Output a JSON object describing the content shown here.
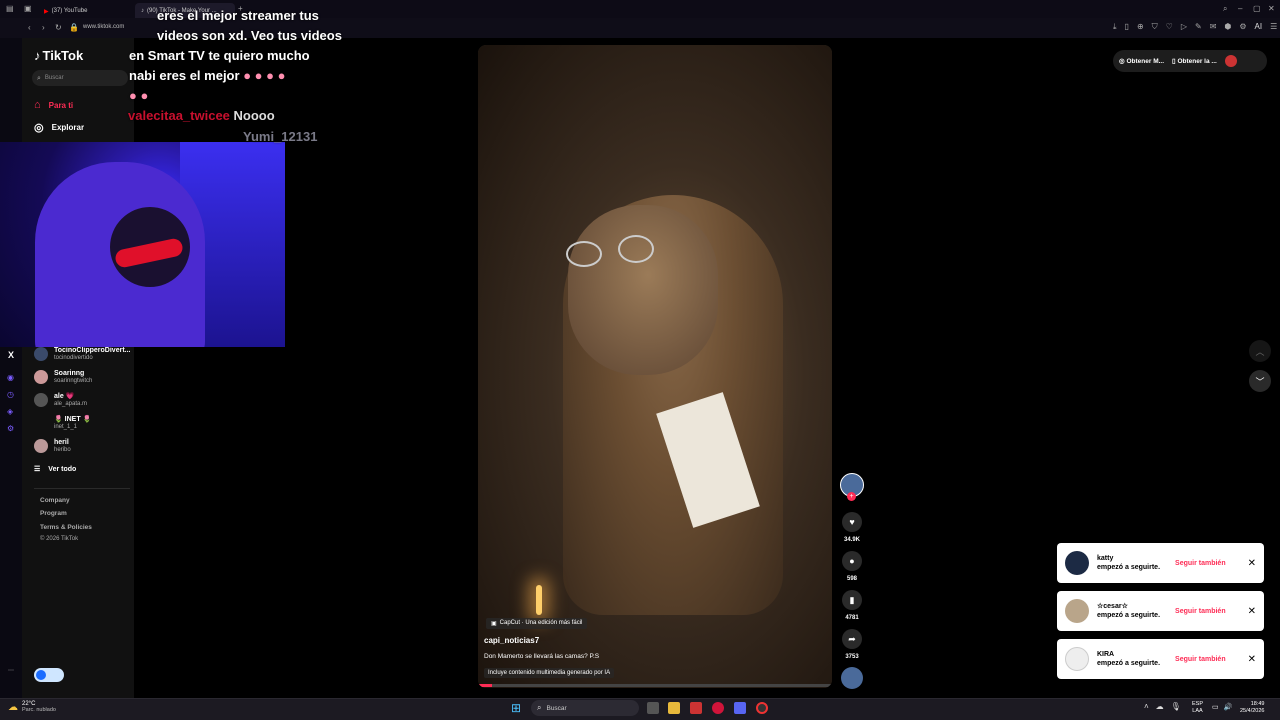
{
  "browser": {
    "tabs": [
      {
        "label": "(37) YouTube"
      },
      {
        "label": "(90) TikTok - Make Your ..."
      }
    ],
    "url": "www.tiktok.com",
    "ai_label": "AI"
  },
  "sidebar": {
    "logo": "TikTok",
    "search_placeholder": "Buscar",
    "nav": [
      {
        "label": "Para ti"
      },
      {
        "label": "Explorar"
      }
    ],
    "following": [
      {
        "name": "TocinoClipperoDivert...",
        "user": "tocinodivertido"
      },
      {
        "name": "Soarinng",
        "user": "soarinngtwitch"
      },
      {
        "name": "ale 💗",
        "user": "ale_apata.m"
      },
      {
        "name": "🌷 INET 🌷",
        "user": "inet_1_1"
      },
      {
        "name": "heril",
        "user": "heribo"
      }
    ],
    "see_all": "Ver todo",
    "footer": [
      "Company",
      "Program",
      "Terms & Policies",
      "© 2026 TikTok"
    ]
  },
  "chat_overlay": {
    "lines": [
      "eres el mejor streamer tus",
      "videos son xd. Veo tus videos",
      "en Smart TV te quiero mucho",
      "nabi eres el mejor"
    ],
    "second_user": "valecitaa_twicee",
    "second_msg": "Noooo",
    "third_user": "Yumi_12131"
  },
  "top_right": {
    "btn1": "Obtener M...",
    "btn2": "Obtener la ..."
  },
  "video": {
    "capcut": "CapCut · Una edición más fácil",
    "author": "capi_noticias7",
    "caption": "Don Mamerto se llevará las camas? P.S",
    "ai_note": "Incluye contenido multimedia generado por IA",
    "likes": "34.9K",
    "comments": "598",
    "saves": "4781",
    "shares": "3753"
  },
  "notifications": [
    {
      "name": "katty",
      "text": "empezó a seguirte.",
      "action": "Seguir también"
    },
    {
      "name": "☆cesar☆",
      "text": "empezó a seguirte.",
      "action": "Seguir también"
    },
    {
      "name": "KIRA",
      "text": "empezó a seguirte.",
      "action": "Seguir también"
    }
  ],
  "taskbar": {
    "weather_temp": "22°C",
    "weather_desc": "Parc. nublado",
    "search": "Buscar",
    "lang1": "ESP",
    "lang2": "LAA",
    "time": "18:49",
    "date": "25/4/2026"
  },
  "colors": {
    "accent": "#fe2c55",
    "chat_user": "#c8102e"
  }
}
